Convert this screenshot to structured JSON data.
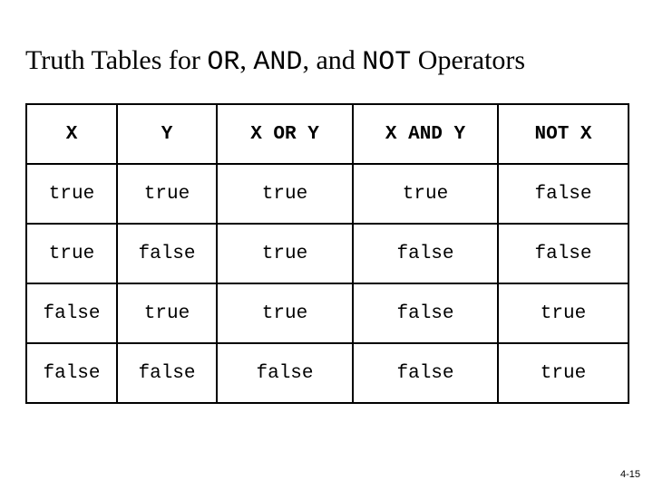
{
  "title": {
    "t1": "Truth Tables for ",
    "op1": "OR",
    "sep1": ", ",
    "op2": "AND",
    "sep2": ", and ",
    "op3": "NOT",
    "t2": "  Operators"
  },
  "headers": [
    "X",
    "Y",
    "X OR Y",
    "X AND Y",
    "NOT X"
  ],
  "rows": [
    [
      "true",
      "true",
      "true",
      "true",
      "false"
    ],
    [
      "true",
      "false",
      "true",
      "false",
      "false"
    ],
    [
      "false",
      "true",
      "true",
      "false",
      "true"
    ],
    [
      "false",
      "false",
      "false",
      "false",
      "true"
    ]
  ],
  "footer": "4-15"
}
